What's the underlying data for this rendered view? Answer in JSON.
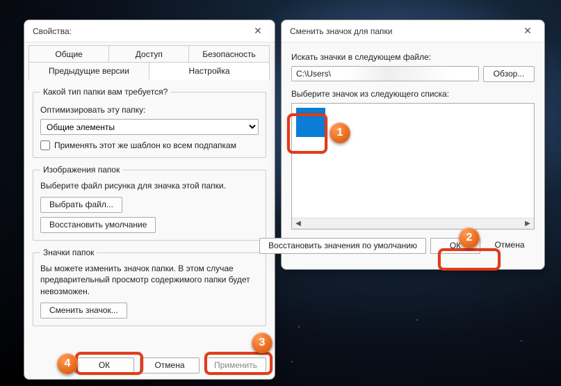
{
  "win1": {
    "title": "Свойства:",
    "tabs_row1": [
      "Общие",
      "Доступ",
      "Безопасность"
    ],
    "tabs_row2": [
      "Предыдущие версии",
      "Настройка"
    ],
    "active_tab": "Настройка",
    "group_type": {
      "legend": "Какой тип папки вам требуется?",
      "optimize_label": "Оптимизировать эту папку:",
      "select_value": "Общие элементы",
      "apply_sub": "Применять этот же шаблон ко всем подпапкам"
    },
    "group_images": {
      "legend": "Изображения папок",
      "note": "Выберите файл рисунка для значка этой папки.",
      "choose_file": "Выбрать файл...",
      "restore": "Восстановить умолчание"
    },
    "group_icons": {
      "legend": "Значки папок",
      "note": "Вы можете изменить значок папки. В этом случае предварительный просмотр содержимого папки будет невозможен.",
      "change_icon": "Сменить значок..."
    },
    "footer": {
      "ok": "ОК",
      "cancel": "Отмена",
      "apply": "Применить"
    }
  },
  "win2": {
    "title": "Сменить значок для папки",
    "search_label": "Искать значки в следующем файле:",
    "path": "C:\\Users\\",
    "browse": "Обзор...",
    "choose_label": "Выберите значок из следующего списка:",
    "restore": "Восстановить значения по умолчанию",
    "ok": "ОК",
    "cancel": "Отмена"
  },
  "markers": {
    "m1": "1",
    "m2": "2",
    "m3": "3",
    "m4": "4"
  }
}
